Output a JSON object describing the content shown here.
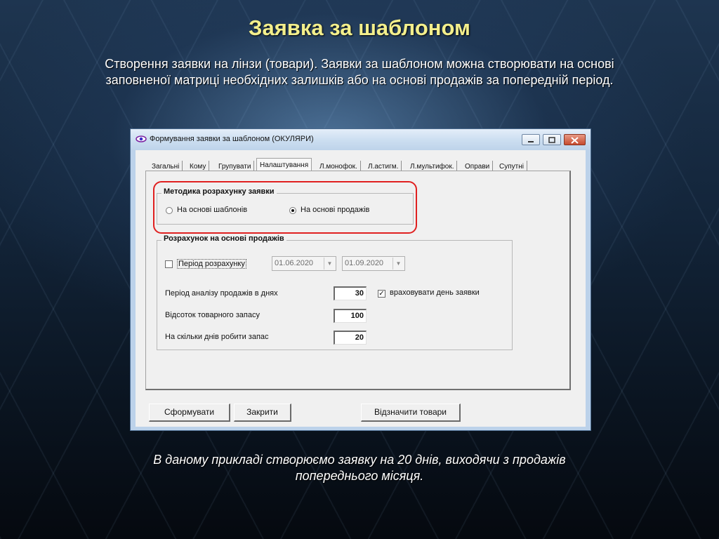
{
  "slide": {
    "title": "Заявка за шаблоном",
    "subtitle": "Створення заявки на лінзи (товари). Заявки за шаблоном можна створювати на основі заповненої матриці необхідних залишків або на основі продажів за попередній період.",
    "caption": "В даному прикладі створюємо заявку на 20 днів, виходячи з продажів попереднього місяця."
  },
  "window": {
    "title": "Формування заявки за шаблоном (ОКУЛЯРИ)",
    "icon": "eye-icon",
    "buttons": {
      "minimize": "minimize-icon",
      "maximize": "maximize-icon",
      "close": "close-icon"
    }
  },
  "tabs": [
    {
      "label": "Загальні"
    },
    {
      "label": "Кому"
    },
    {
      "label": "Групувати"
    },
    {
      "label": "Налаштування",
      "active": true
    },
    {
      "label": "Л.монофок."
    },
    {
      "label": "Л.астигм."
    },
    {
      "label": "Л.мультифок."
    },
    {
      "label": "Оправи"
    },
    {
      "label": "Супутні"
    }
  ],
  "method_group": {
    "title": "Методика розрахунку заявки",
    "option_templates": "На основі шаблонів",
    "option_sales": "На основі продажів",
    "selected": "sales",
    "highlight_color": "#e02020"
  },
  "sales_group": {
    "title": "Розрахунок на основі продажів",
    "period_label": "Період розрахунку",
    "period_checked": false,
    "date_from": "01.06.2020",
    "date_to": "01.09.2020",
    "analysis_days_label": "Період аналізу продажів в днях",
    "analysis_days_value": "30",
    "count_order_day_label": "враховувати день заявки",
    "count_order_day_checked": true,
    "stock_percent_label": "Відсоток товарного запасу",
    "stock_percent_value": "100",
    "stock_days_label": "На скільки днів робити запас",
    "stock_days_value": "20"
  },
  "actions": {
    "form": "Сформувати",
    "close": "Закрити",
    "mark_goods": "Відзначити товари"
  }
}
